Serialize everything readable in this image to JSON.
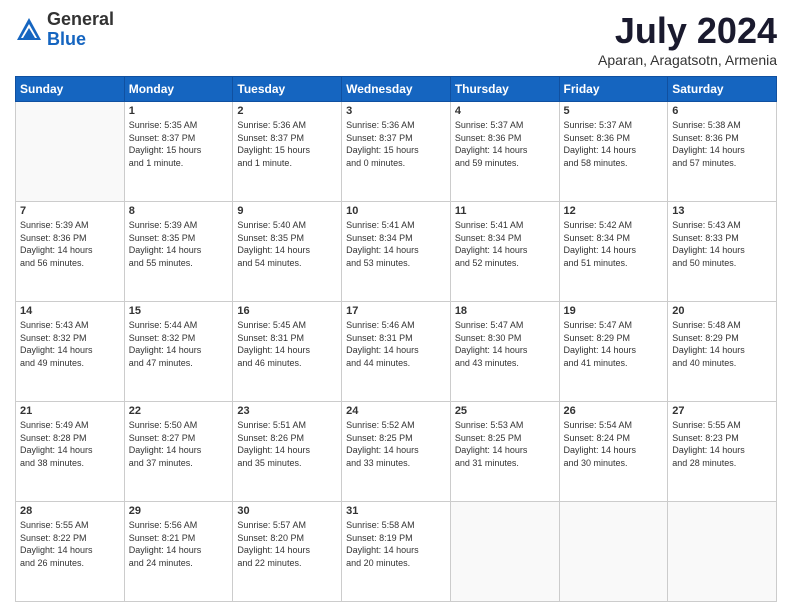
{
  "logo": {
    "general": "General",
    "blue": "Blue"
  },
  "header": {
    "month": "July 2024",
    "location": "Aparan, Aragatsotn, Armenia"
  },
  "weekdays": [
    "Sunday",
    "Monday",
    "Tuesday",
    "Wednesday",
    "Thursday",
    "Friday",
    "Saturday"
  ],
  "weeks": [
    [
      {
        "day": "",
        "info": ""
      },
      {
        "day": "1",
        "info": "Sunrise: 5:35 AM\nSunset: 8:37 PM\nDaylight: 15 hours\nand 1 minute."
      },
      {
        "day": "2",
        "info": "Sunrise: 5:36 AM\nSunset: 8:37 PM\nDaylight: 15 hours\nand 1 minute."
      },
      {
        "day": "3",
        "info": "Sunrise: 5:36 AM\nSunset: 8:37 PM\nDaylight: 15 hours\nand 0 minutes."
      },
      {
        "day": "4",
        "info": "Sunrise: 5:37 AM\nSunset: 8:36 PM\nDaylight: 14 hours\nand 59 minutes."
      },
      {
        "day": "5",
        "info": "Sunrise: 5:37 AM\nSunset: 8:36 PM\nDaylight: 14 hours\nand 58 minutes."
      },
      {
        "day": "6",
        "info": "Sunrise: 5:38 AM\nSunset: 8:36 PM\nDaylight: 14 hours\nand 57 minutes."
      }
    ],
    [
      {
        "day": "7",
        "info": "Sunrise: 5:39 AM\nSunset: 8:36 PM\nDaylight: 14 hours\nand 56 minutes."
      },
      {
        "day": "8",
        "info": "Sunrise: 5:39 AM\nSunset: 8:35 PM\nDaylight: 14 hours\nand 55 minutes."
      },
      {
        "day": "9",
        "info": "Sunrise: 5:40 AM\nSunset: 8:35 PM\nDaylight: 14 hours\nand 54 minutes."
      },
      {
        "day": "10",
        "info": "Sunrise: 5:41 AM\nSunset: 8:34 PM\nDaylight: 14 hours\nand 53 minutes."
      },
      {
        "day": "11",
        "info": "Sunrise: 5:41 AM\nSunset: 8:34 PM\nDaylight: 14 hours\nand 52 minutes."
      },
      {
        "day": "12",
        "info": "Sunrise: 5:42 AM\nSunset: 8:34 PM\nDaylight: 14 hours\nand 51 minutes."
      },
      {
        "day": "13",
        "info": "Sunrise: 5:43 AM\nSunset: 8:33 PM\nDaylight: 14 hours\nand 50 minutes."
      }
    ],
    [
      {
        "day": "14",
        "info": "Sunrise: 5:43 AM\nSunset: 8:32 PM\nDaylight: 14 hours\nand 49 minutes."
      },
      {
        "day": "15",
        "info": "Sunrise: 5:44 AM\nSunset: 8:32 PM\nDaylight: 14 hours\nand 47 minutes."
      },
      {
        "day": "16",
        "info": "Sunrise: 5:45 AM\nSunset: 8:31 PM\nDaylight: 14 hours\nand 46 minutes."
      },
      {
        "day": "17",
        "info": "Sunrise: 5:46 AM\nSunset: 8:31 PM\nDaylight: 14 hours\nand 44 minutes."
      },
      {
        "day": "18",
        "info": "Sunrise: 5:47 AM\nSunset: 8:30 PM\nDaylight: 14 hours\nand 43 minutes."
      },
      {
        "day": "19",
        "info": "Sunrise: 5:47 AM\nSunset: 8:29 PM\nDaylight: 14 hours\nand 41 minutes."
      },
      {
        "day": "20",
        "info": "Sunrise: 5:48 AM\nSunset: 8:29 PM\nDaylight: 14 hours\nand 40 minutes."
      }
    ],
    [
      {
        "day": "21",
        "info": "Sunrise: 5:49 AM\nSunset: 8:28 PM\nDaylight: 14 hours\nand 38 minutes."
      },
      {
        "day": "22",
        "info": "Sunrise: 5:50 AM\nSunset: 8:27 PM\nDaylight: 14 hours\nand 37 minutes."
      },
      {
        "day": "23",
        "info": "Sunrise: 5:51 AM\nSunset: 8:26 PM\nDaylight: 14 hours\nand 35 minutes."
      },
      {
        "day": "24",
        "info": "Sunrise: 5:52 AM\nSunset: 8:25 PM\nDaylight: 14 hours\nand 33 minutes."
      },
      {
        "day": "25",
        "info": "Sunrise: 5:53 AM\nSunset: 8:25 PM\nDaylight: 14 hours\nand 31 minutes."
      },
      {
        "day": "26",
        "info": "Sunrise: 5:54 AM\nSunset: 8:24 PM\nDaylight: 14 hours\nand 30 minutes."
      },
      {
        "day": "27",
        "info": "Sunrise: 5:55 AM\nSunset: 8:23 PM\nDaylight: 14 hours\nand 28 minutes."
      }
    ],
    [
      {
        "day": "28",
        "info": "Sunrise: 5:55 AM\nSunset: 8:22 PM\nDaylight: 14 hours\nand 26 minutes."
      },
      {
        "day": "29",
        "info": "Sunrise: 5:56 AM\nSunset: 8:21 PM\nDaylight: 14 hours\nand 24 minutes."
      },
      {
        "day": "30",
        "info": "Sunrise: 5:57 AM\nSunset: 8:20 PM\nDaylight: 14 hours\nand 22 minutes."
      },
      {
        "day": "31",
        "info": "Sunrise: 5:58 AM\nSunset: 8:19 PM\nDaylight: 14 hours\nand 20 minutes."
      },
      {
        "day": "",
        "info": ""
      },
      {
        "day": "",
        "info": ""
      },
      {
        "day": "",
        "info": ""
      }
    ]
  ]
}
